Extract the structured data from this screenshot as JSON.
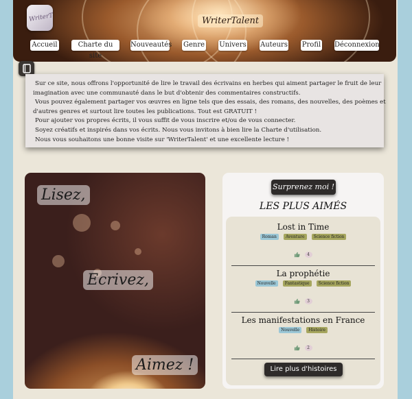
{
  "site": {
    "brand": "WriterTalent",
    "logo_text": "WriterTalent"
  },
  "nav": [
    {
      "label": "Accueil"
    },
    {
      "label": "Charte du site"
    },
    {
      "label": "Nouveautés"
    },
    {
      "label": "Genre"
    },
    {
      "label": "Univers"
    },
    {
      "label": "Auteurs"
    },
    {
      "label": "Profil"
    },
    {
      "label": "Déconnexion"
    }
  ],
  "intro": {
    "lines": [
      "Sur ce site, nous offrons l'opportunité de lire le travail des écrivains en herbes qui aiment partager le fruit de leur",
      "imagination avec une communauté dans le but d'obtenir des commentaires constructifs.",
      "Vous pouvez également partager vos œuvres en ligne tels que des essais, des romans, des nouvelles, des poèmes et",
      "d'autres genres et surtout lire toutes les publications. Tout est GRATUIT !",
      "Pour ajouter vos propres écrits, il vous suffit de vous inscrire et/ou de vous connecter.",
      "Soyez créatifs et inspirés dans vos écrits. Nous vous invitons à bien lire la Charte d'utilisation.",
      "Nous vous souhaitons une bonne visite sur 'WriterTalent' et une excellente lecture !"
    ]
  },
  "hero": {
    "words": [
      "Lisez,",
      "Ecrivez,",
      "Aimez !"
    ]
  },
  "panel": {
    "surprise_label": "Surprenez moi !",
    "title": "LES PLUS AIMÉS",
    "more_label": "Lire plus d'histoires",
    "stories": [
      {
        "title": "Lost in Time",
        "kind": "Roman",
        "genres": [
          "Aventure",
          "Science fiction"
        ],
        "likes": "4"
      },
      {
        "title": "La prophétie",
        "kind": "Nouvelle",
        "genres": [
          "Fantastique",
          "Science fiction"
        ],
        "likes": "3"
      },
      {
        "title": "Les manifestations en France",
        "kind": "Nouvelle",
        "genres": [
          "Histoire"
        ],
        "likes": "2"
      }
    ]
  },
  "colors": {
    "background": "#a9cfdc",
    "page": "#ebe6d9",
    "dark_button": "#2e2b2a",
    "kind_tag": "#9bc7d6",
    "genre_tag": "#a6a65e",
    "thumb": "#6f9a78"
  }
}
